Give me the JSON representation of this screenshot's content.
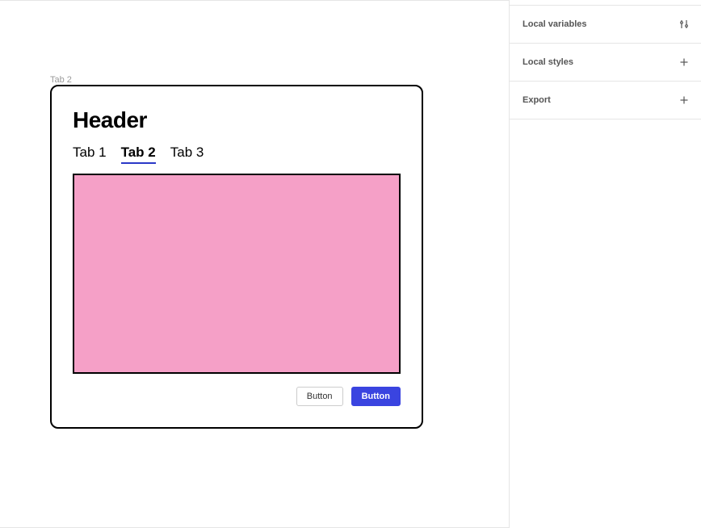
{
  "canvas": {
    "frame_label": "Tab 2",
    "header": "Header",
    "tabs": [
      "Tab 1",
      "Tab 2",
      "Tab 3"
    ],
    "active_tab_index": 1,
    "content_fill": "#f5a0c7",
    "buttons": {
      "secondary": "Button",
      "primary": "Button"
    }
  },
  "sidebar": {
    "sections": [
      {
        "label": "Local variables",
        "icon": "sliders"
      },
      {
        "label": "Local styles",
        "icon": "plus"
      },
      {
        "label": "Export",
        "icon": "plus"
      }
    ]
  }
}
